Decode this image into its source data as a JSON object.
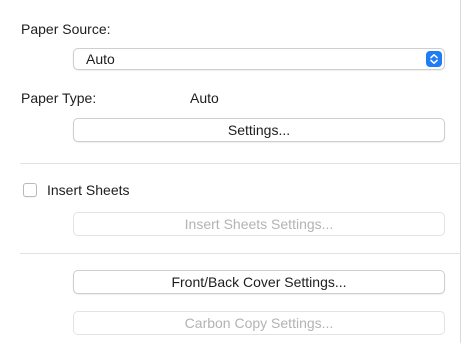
{
  "paper_source": {
    "label": "Paper Source:",
    "selected": "Auto"
  },
  "paper_type": {
    "label": "Paper Type:",
    "value": "Auto"
  },
  "buttons": {
    "settings": "Settings...",
    "insert_sheets_settings": "Insert Sheets Settings...",
    "front_back_cover_settings": "Front/Back Cover Settings...",
    "carbon_copy_settings": "Carbon Copy Settings..."
  },
  "insert_sheets": {
    "label": "Insert Sheets",
    "checked": false
  },
  "colors": {
    "accent": "#1f7cf7",
    "disabled_text": "#b3b3b3"
  }
}
